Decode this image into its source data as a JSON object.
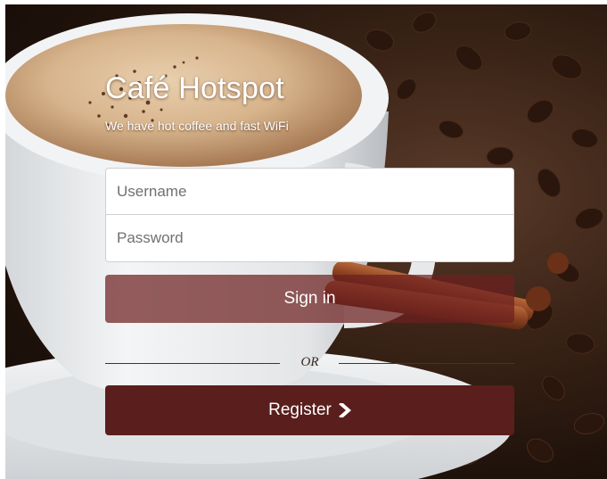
{
  "header": {
    "title": "Café Hotspot",
    "subtitle": "We have hot coffee and fast WiFi"
  },
  "form": {
    "username_placeholder": "Username",
    "password_placeholder": "Password",
    "signin_label": "Sign in",
    "divider_text": "OR",
    "register_label": "Register"
  },
  "icons": {
    "register": "chevron-right-icon",
    "background": "coffee-cup-photo"
  },
  "colors": {
    "brand_dark": "#5a1e1c",
    "signin_bg": "rgba(110,32,32,0.72)",
    "divider": "#6b2320"
  }
}
